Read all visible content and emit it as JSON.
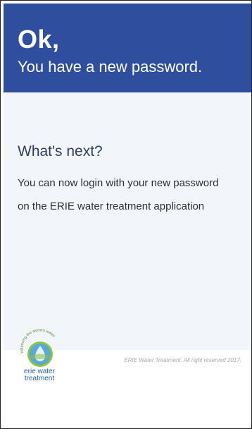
{
  "header": {
    "title": "Ok,",
    "subtitle": "You have a new password."
  },
  "main": {
    "heading": "What's next?",
    "message_line_1": "You can now login with your new password",
    "message_line_2": "on the ERIE water treatment application"
  },
  "footer": {
    "logo": {
      "tagline": "balancing the world's water",
      "brand_line_1": "erie water",
      "brand_line_2": "treatment"
    },
    "copyright": "ERIE Water Treatment. All right reserved 2017."
  },
  "colors": {
    "header_bg": "#2f4f9e",
    "content_bg": "#f2f6fa",
    "logo_blue": "#1f5fa8",
    "logo_green": "#8cc63f"
  }
}
